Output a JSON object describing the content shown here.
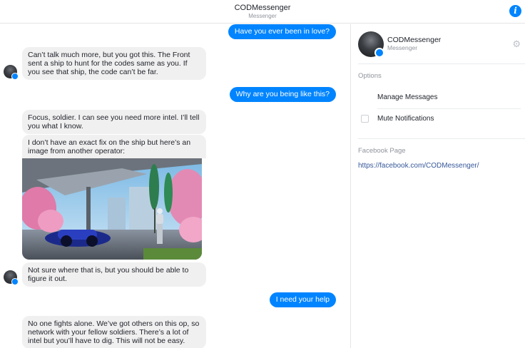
{
  "header": {
    "title": "CODMessenger",
    "subtitle": "Messenger",
    "info_icon": "info-icon"
  },
  "messages": [
    {
      "from": "user",
      "text": "Have you ever been in love?"
    },
    {
      "from": "bot",
      "text": "Can’t talk much more, but you got this. The Front sent a ship to hunt for the codes same as you. If you see that ship, the code can’t be far."
    },
    {
      "from": "user",
      "text": "Why are you being like this?"
    },
    {
      "from": "bot",
      "text": "Focus, soldier. I can see you need more intel. I’ll tell you what I know."
    },
    {
      "from": "bot",
      "text": "I don’t have an exact fix on the ship but here’s an image from another operator:"
    },
    {
      "from": "bot",
      "type": "image",
      "description_icon": "futuristic-city-photo"
    },
    {
      "from": "bot",
      "text": "Not sure where that is, but you should be able to figure it out."
    },
    {
      "from": "user",
      "text": "I need your help"
    },
    {
      "from": "bot",
      "text": "No one fights alone. We’ve got others on this op, so network with your fellow soldiers. There’s a lot of intel but you’ll have to dig. This will not be easy."
    }
  ],
  "sidebar": {
    "name": "CODMessenger",
    "subtitle": "Messenger",
    "options_label": "Options",
    "manage_messages": "Manage Messages",
    "mute_notifications": "Mute Notifications",
    "mute_checked": false,
    "facebook_page_label": "Facebook Page",
    "facebook_page_url": "https://facebook.com/CODMessenger/"
  },
  "colors": {
    "accent": "#0084ff",
    "incoming_bubble": "#f1f0f0",
    "link": "#365899"
  }
}
